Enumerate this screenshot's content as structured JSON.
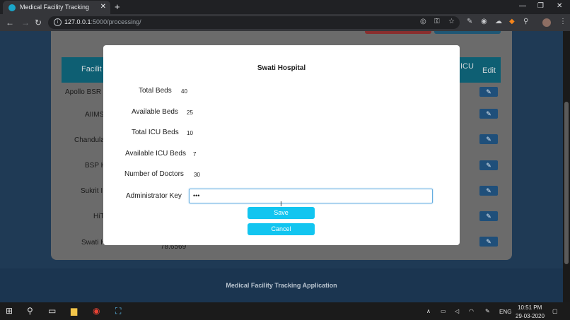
{
  "browser": {
    "tab_title": "Medical Facility Tracking",
    "tab_close": "✕",
    "new_tab": "+",
    "url_host": "127.0.0.1",
    "url_rest": ":5000/processing/"
  },
  "table": {
    "headers": {
      "facility": "Facilit",
      "icu": "ICU",
      "edit": "Edit"
    },
    "rows": [
      {
        "name": "Apollo BSR H"
      },
      {
        "name": "AIIMS"
      },
      {
        "name": "Chandula"
      },
      {
        "name": "BSP H"
      },
      {
        "name": "Sukrit I"
      },
      {
        "name": "HiT"
      },
      {
        "name": "Swati H",
        "lat": "78.6569"
      }
    ],
    "edit_icon": "✎"
  },
  "modal": {
    "title": "Swati Hospital",
    "fields": [
      {
        "label": "Total Beds",
        "value": "40"
      },
      {
        "label": "Available Beds",
        "value": "25"
      },
      {
        "label": "Total ICU Beds",
        "value": "10"
      },
      {
        "label": "Available ICU Beds",
        "value": "7"
      },
      {
        "label": "Number of Doctors",
        "value": "30"
      }
    ],
    "admin_label": "Administrator Key",
    "admin_value": "•••",
    "save_label": "Save",
    "cancel_label": "Cancel"
  },
  "footer": {
    "text": "Medical Facility Tracking Application"
  },
  "taskbar": {
    "language": "ENG",
    "time": "10:51 PM",
    "date": "29-03-2020"
  },
  "colors": {
    "accent": "#12c5f0",
    "table_header": "#0e5f73",
    "page_bg": "#1f3a55"
  }
}
